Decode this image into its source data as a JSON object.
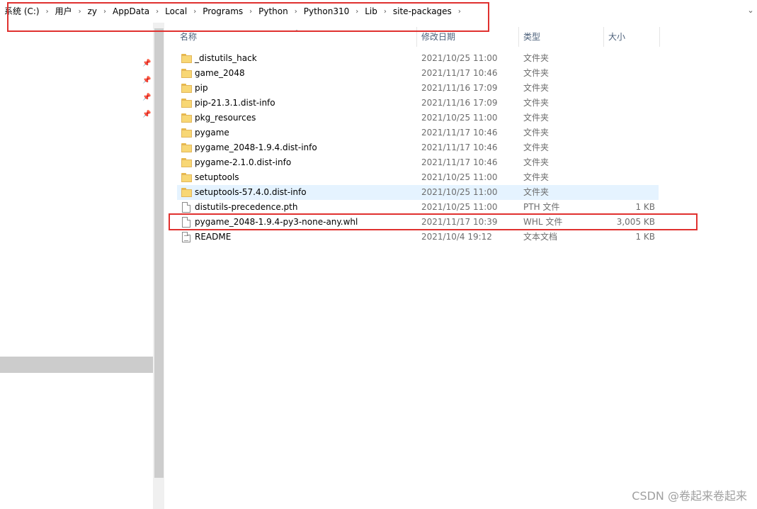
{
  "address_bar": {
    "breadcrumbs": [
      "系统 (C:)",
      "用户",
      "zy",
      "AppData",
      "Local",
      "Programs",
      "Python",
      "Python310",
      "Lib",
      "site-packages"
    ],
    "separator_icon": "chevron-right-icon",
    "dropdown_icon": "chevron-down-icon"
  },
  "columns": {
    "name": "名称",
    "date": "修改日期",
    "type": "类型",
    "size": "大小"
  },
  "files": [
    {
      "name": "_distutils_hack",
      "date": "2021/10/25 11:00",
      "type": "文件夹",
      "size": "",
      "icon": "folder-icon"
    },
    {
      "name": "game_2048",
      "date": "2021/11/17 10:46",
      "type": "文件夹",
      "size": "",
      "icon": "folder-icon"
    },
    {
      "name": "pip",
      "date": "2021/11/16 17:09",
      "type": "文件夹",
      "size": "",
      "icon": "folder-icon"
    },
    {
      "name": "pip-21.3.1.dist-info",
      "date": "2021/11/16 17:09",
      "type": "文件夹",
      "size": "",
      "icon": "folder-icon"
    },
    {
      "name": "pkg_resources",
      "date": "2021/10/25 11:00",
      "type": "文件夹",
      "size": "",
      "icon": "folder-icon"
    },
    {
      "name": "pygame",
      "date": "2021/11/17 10:46",
      "type": "文件夹",
      "size": "",
      "icon": "folder-icon"
    },
    {
      "name": "pygame_2048-1.9.4.dist-info",
      "date": "2021/11/17 10:46",
      "type": "文件夹",
      "size": "",
      "icon": "folder-icon"
    },
    {
      "name": "pygame-2.1.0.dist-info",
      "date": "2021/11/17 10:46",
      "type": "文件夹",
      "size": "",
      "icon": "folder-icon"
    },
    {
      "name": "setuptools",
      "date": "2021/10/25 11:00",
      "type": "文件夹",
      "size": "",
      "icon": "folder-icon"
    },
    {
      "name": "setuptools-57.4.0.dist-info",
      "date": "2021/10/25 11:00",
      "type": "文件夹",
      "size": "",
      "icon": "folder-icon"
    },
    {
      "name": "distutils-precedence.pth",
      "date": "2021/10/25 11:00",
      "type": "PTH 文件",
      "size": "1 KB",
      "icon": "file-icon"
    },
    {
      "name": "pygame_2048-1.9.4-py3-none-any.whl",
      "date": "2021/11/17 10:39",
      "type": "WHL 文件",
      "size": "3,005 KB",
      "icon": "file-icon"
    },
    {
      "name": "README",
      "date": "2021/10/4 19:12",
      "type": "文本文档",
      "size": "1 KB",
      "icon": "text-file-icon"
    }
  ],
  "hovered_row_index": 9,
  "highlighted_row_index": 11,
  "nav_pane": {
    "pin_icon": "pin-icon"
  },
  "watermark": "CSDN @卷起来卷起来",
  "colors": {
    "highlight_red": "#e0312f",
    "hover_blue": "#e5f3ff",
    "folder_yellow": "#f8d775"
  }
}
